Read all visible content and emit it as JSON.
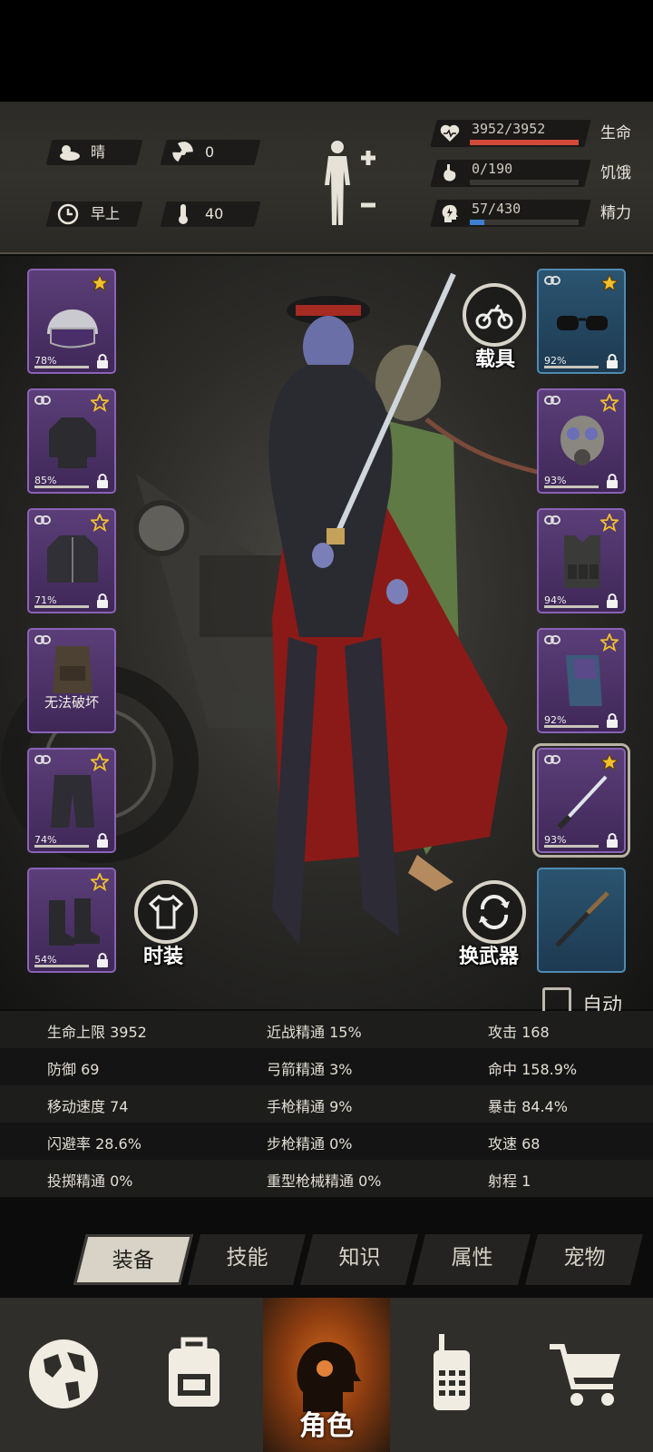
{
  "environment": {
    "weather": "晴",
    "radiation": "0",
    "time_of_day": "早上",
    "temperature": "40"
  },
  "vitals": [
    {
      "value": "3952/3952",
      "label": "生命",
      "level": 1.0,
      "color": "#d2493a",
      "icon": "heart-icon"
    },
    {
      "value": "0/190",
      "label": "饥饿",
      "level": 0.0,
      "color": "#7a7670",
      "icon": "stomach-icon"
    },
    {
      "value": "57/430",
      "label": "精力",
      "level": 0.13,
      "color": "#3d7fd0",
      "icon": "head-energy-icon"
    }
  ],
  "left_slots": [
    {
      "name": "helmet-slot",
      "pct": "78%",
      "icon": "police-helmet-icon",
      "starred": true
    },
    {
      "name": "shirt-slot",
      "pct": "85%",
      "icon": "sweater-icon",
      "starred": false
    },
    {
      "name": "jacket-slot",
      "pct": "71%",
      "icon": "jacket-icon",
      "starred": false
    },
    {
      "name": "backpack-slot",
      "pct": "",
      "note": "无法破坏",
      "icon": "backpack-icon",
      "starred": false
    },
    {
      "name": "pants-slot",
      "pct": "74%",
      "icon": "pants-icon",
      "starred": false
    },
    {
      "name": "boots-slot",
      "pct": "54%",
      "icon": "boots-icon",
      "starred": false
    }
  ],
  "right_slots": [
    {
      "name": "glasses-slot",
      "pct": "92%",
      "icon": "sunglasses-icon",
      "starred": true,
      "color": "blue"
    },
    {
      "name": "mask-slot",
      "pct": "93%",
      "icon": "gas-mask-icon",
      "starred": false,
      "color": "purple"
    },
    {
      "name": "vest-slot",
      "pct": "94%",
      "icon": "tactical-vest-icon",
      "starred": false,
      "color": "purple"
    },
    {
      "name": "gloves-slot",
      "pct": "92%",
      "icon": "gloves-icon",
      "starred": false,
      "color": "purple"
    },
    {
      "name": "weapon-slot",
      "pct": "93%",
      "icon": "katana-icon",
      "starred": true,
      "color": "purple",
      "selected": true
    },
    {
      "name": "secondary-weapon-slot",
      "pct": "",
      "icon": "knife-icon",
      "starred": false,
      "color": "blue"
    }
  ],
  "buttons": {
    "vehicle": "载具",
    "fashion": "时装",
    "switch_weapon": "换武器",
    "auto": "自动"
  },
  "stats": [
    [
      "生命上限 3952",
      "近战精通 15%",
      "攻击 168"
    ],
    [
      "防御 69",
      "弓箭精通 3%",
      "命中 158.9%"
    ],
    [
      "移动速度 74",
      "手枪精通 9%",
      "暴击 84.4%"
    ],
    [
      "闪避率 28.6%",
      "步枪精通 0%",
      "攻速 68"
    ],
    [
      "投掷精通 0%",
      "重型枪械精通 0%",
      "射程 1"
    ]
  ],
  "tabs": [
    "装备",
    "技能",
    "知识",
    "属性",
    "宠物"
  ],
  "active_tab": 0,
  "nav": {
    "items": [
      "world-map-icon",
      "backpack-icon",
      "character-icon",
      "walkie-talkie-icon",
      "shop-cart-icon"
    ],
    "active_label": "角色"
  }
}
